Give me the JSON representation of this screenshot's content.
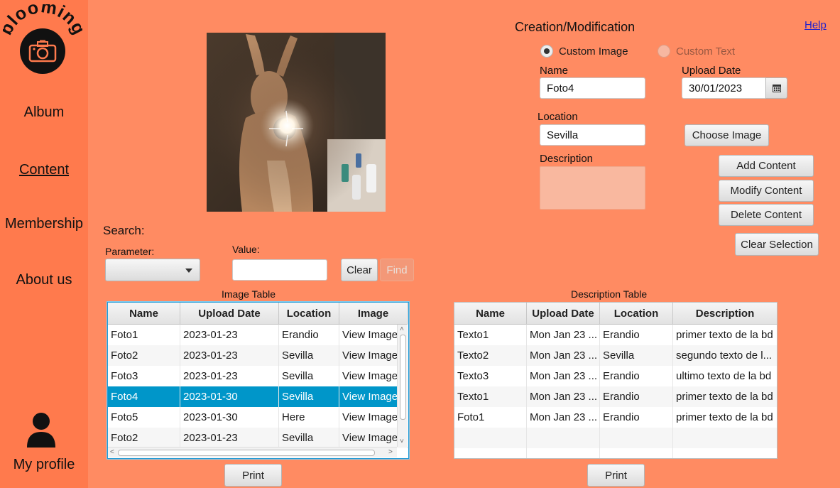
{
  "sidebar": {
    "logo_text": "blooming",
    "nav": {
      "album": "Album",
      "content": "Content",
      "membership": "Membership",
      "about": "About us",
      "profile": "My profile"
    }
  },
  "form": {
    "heading": "Creation/Modification",
    "help": "Help",
    "radio_image": "Custom Image",
    "radio_text": "Custom Text",
    "name_label": "Name",
    "name_value": "Foto4",
    "upload_label": "Upload Date",
    "upload_value": "30/01/2023",
    "location_label": "Location",
    "location_value": "Sevilla",
    "description_label": "Description",
    "choose_image": "Choose Image",
    "add": "Add Content",
    "modify": "Modify Content",
    "delete": "Delete Content",
    "clear_selection": "Clear Selection"
  },
  "search": {
    "title": "Search:",
    "parameter_label": "Parameter:",
    "parameter_value": "",
    "value_label": "Value:",
    "value_text": "",
    "clear": "Clear",
    "find": "Find"
  },
  "image_table": {
    "title": "Image Table",
    "columns": [
      "Name",
      "Upload Date",
      "Location",
      "Image"
    ],
    "rows": [
      [
        "Foto1",
        "2023-01-23",
        "Erandio",
        "View Image"
      ],
      [
        "Foto2",
        "2023-01-23",
        "Sevilla",
        "View Image"
      ],
      [
        "Foto3",
        "2023-01-23",
        "Sevilla",
        "View Image"
      ],
      [
        "Foto4",
        "2023-01-30",
        "Sevilla",
        "View Image"
      ],
      [
        "Foto5",
        "2023-01-30",
        "Here",
        "View Image"
      ],
      [
        "Foto2",
        "2023-01-23",
        "Sevilla",
        "View Image"
      ]
    ],
    "selected_row": 3,
    "print": "Print"
  },
  "description_table": {
    "title": "Description Table",
    "columns": [
      "Name",
      "Upload Date",
      "Location",
      "Description"
    ],
    "rows": [
      [
        "Texto1",
        "Mon Jan 23 ...",
        "Erandio",
        "primer texto de la bd"
      ],
      [
        "Texto2",
        "Mon Jan 23 ...",
        "Sevilla",
        "segundo texto de l..."
      ],
      [
        "Texto3",
        "Mon Jan 23 ...",
        "Erandio",
        "ultimo texto de la bd"
      ],
      [
        "Texto1",
        "Mon Jan 23 ...",
        "Erandio",
        "primer texto de la bd"
      ],
      [
        "Foto1",
        "Mon Jan 23 ...",
        "Erandio",
        "primer texto de la bd"
      ]
    ],
    "print": "Print"
  },
  "colors": {
    "background": "#ff8b62",
    "sidebar": "#ff7a4d",
    "selection": "#0096c9",
    "link": "#2222cc"
  }
}
